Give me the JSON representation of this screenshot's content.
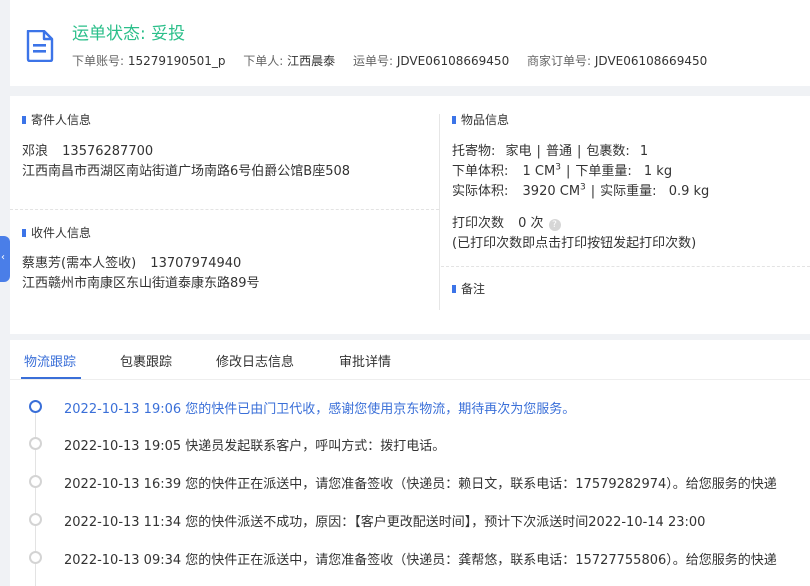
{
  "header": {
    "status_title": "运单状态: 妥投",
    "meta": [
      {
        "label": "下单账号: ",
        "value": "15279190501_p"
      },
      {
        "label": "下单人: ",
        "value": "江西晨泰"
      },
      {
        "label": "运单号: ",
        "value": "JDVE06108669450"
      },
      {
        "label": "商家订单号: ",
        "value": "JDVE06108669450"
      }
    ]
  },
  "sender": {
    "section_title": "寄件人信息",
    "name": "邓浪",
    "phone": "13576287700",
    "address": "江西南昌市西湖区南站街道广场南路6号伯爵公馆B座508"
  },
  "receiver": {
    "section_title": "收件人信息",
    "name": "蔡惠芳(需本人签收)",
    "phone": "13707974940",
    "address": "江西赣州市南康区东山街道泰康东路89号"
  },
  "goods": {
    "section_title": "物品信息",
    "consign_label": "托寄物:",
    "consign_value": "家电",
    "consign_type": "普通",
    "pkg_label": "包裹数:",
    "pkg_value": "1",
    "order_vol_label": "下单体积:",
    "order_vol_value": "1 CM",
    "order_vol_sup": "3",
    "order_weight_label": "下单重量:",
    "order_weight_value": "1 kg",
    "actual_vol_label": "实际体积:",
    "actual_vol_value": "3920 CM",
    "actual_vol_sup": "3",
    "actual_weight_label": "实际重量:",
    "actual_weight_value": "0.9 kg",
    "print_label": "打印次数",
    "print_value": "0 次",
    "print_note": "(已打印次数即点击打印按钮发起打印次数)",
    "help_glyph": "?"
  },
  "remark": {
    "section_title": "备注"
  },
  "side_tab": {
    "glyph": "‹"
  },
  "tabs": [
    {
      "label": "物流跟踪",
      "active": true
    },
    {
      "label": "包裹跟踪",
      "active": false
    },
    {
      "label": "修改日志信息",
      "active": false
    },
    {
      "label": "审批详情",
      "active": false
    }
  ],
  "timeline": [
    {
      "text": "2022-10-13 19:06 您的快件已由门卫代收，感谢您使用京东物流，期待再次为您服务。",
      "active": true
    },
    {
      "text": "2022-10-13 19:05 快递员发起联系客户，呼叫方式：拨打电话。",
      "active": false
    },
    {
      "text": "2022-10-13 16:39 您的快件正在派送中，请您准备签收（快递员：赖日文，联系电话：17579282974）。给您服务的快递",
      "active": false
    },
    {
      "text": "2022-10-13 11:34 您的快件派送不成功，原因：【客户更改配送时间】，预计下次派送时间2022-10-14 23:00",
      "active": false
    },
    {
      "text": "2022-10-13 09:34 您的快件正在派送中，请您准备签收（快递员：龚帮悠，联系电话：15727755806）。给您服务的快递",
      "active": false
    }
  ]
}
